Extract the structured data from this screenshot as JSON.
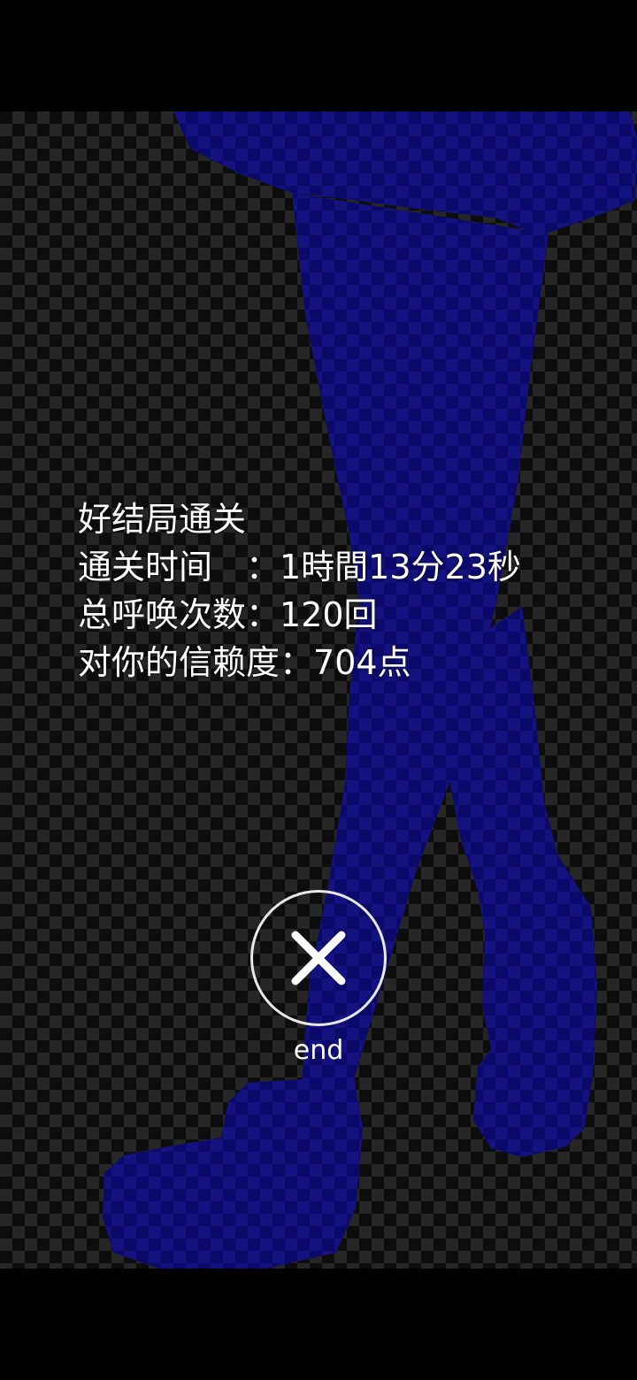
{
  "result": {
    "title": "好结局通关",
    "clear_time_label": "通关时间",
    "clear_time_value": "1時間13分23秒",
    "call_count_label": "总呼唤次数",
    "call_count_value": "120回",
    "trust_label": "对你的信赖度",
    "trust_value": "704点",
    "separator": "："
  },
  "end_button": {
    "label": "end",
    "icon": "close-x-icon"
  },
  "colors": {
    "silhouette": "#0b0a6b",
    "text": "#ffffff",
    "button_ring": "#e8e8e8"
  }
}
